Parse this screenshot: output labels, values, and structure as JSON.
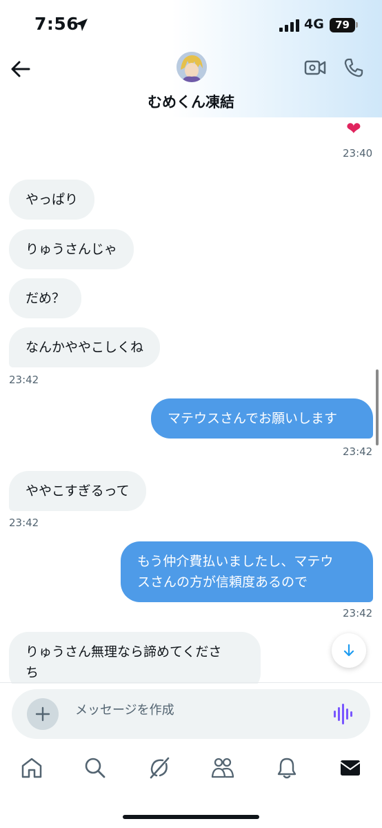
{
  "status": {
    "time": "7:56",
    "network": "4G",
    "battery": "79"
  },
  "header": {
    "contact_name": "むめくん凍結"
  },
  "messages": [
    {
      "text": "やっぱり"
    },
    {
      "text": "りゅうさんじゃ"
    },
    {
      "text": "だめ？"
    },
    {
      "text": "なんかややこしくね"
    },
    {
      "text": "マテウスさんでお願いします"
    },
    {
      "text": "ややこすぎるって"
    },
    {
      "text": "もう仲介費払いましたし、マテウ"
    },
    {
      "text": "スさんの方が信頼度あるので"
    },
    {
      "text": "りゅうさん無理なら諦めてくださ"
    },
    {
      "text": "ち"
    }
  ],
  "timestamps": [
    "23:40",
    "23:42",
    "23:42",
    "23:42",
    "23:42"
  ],
  "reaction": "❤",
  "composer": {
    "placeholder": "メッセージを作成"
  },
  "colors": {
    "outgoing_bubble": "#4e9be8",
    "incoming_bubble": "#eff3f4",
    "accent": "#1d9bf0",
    "voice": "#7856ff"
  },
  "icons": {
    "back": "back-arrow-icon",
    "video": "video-call-icon",
    "phone": "phone-icon",
    "plus": "plus-icon",
    "voice": "voice-wave-icon",
    "scroll": "arrow-down-icon",
    "tabs": [
      "home-icon",
      "search-icon",
      "grok-icon",
      "communities-icon",
      "bell-icon",
      "mail-icon"
    ]
  }
}
